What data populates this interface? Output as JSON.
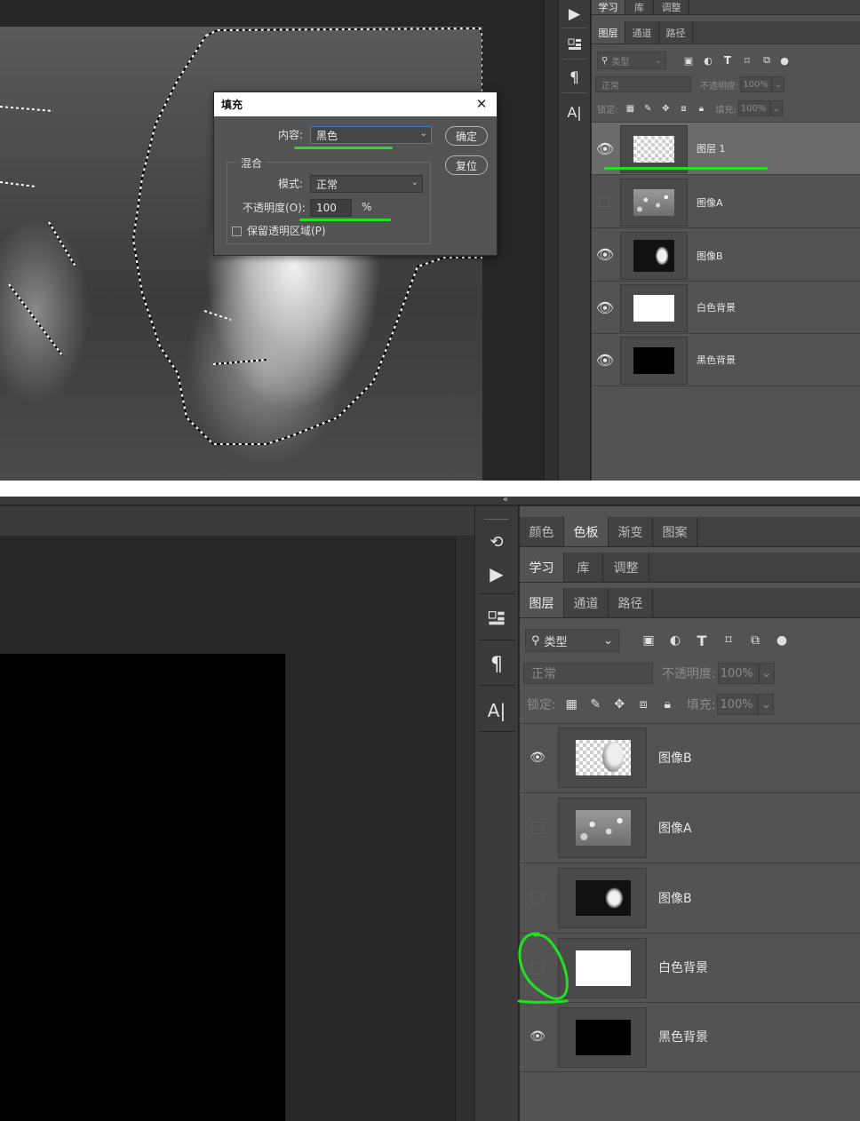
{
  "top": {
    "panel_tabs_a": [
      "学习",
      "库",
      "调整"
    ],
    "panel_tabs_b": [
      "图层",
      "通道",
      "路径"
    ],
    "filter": {
      "label": "类型"
    },
    "blend_mode": "正常",
    "opacity": {
      "label": "不透明度:",
      "value": "100%"
    },
    "lock": {
      "label": "锁定:"
    },
    "fill": {
      "label": "填充:",
      "value": "100%"
    },
    "layers": [
      {
        "name": "图层 1",
        "visible": true,
        "thumb": "transparent",
        "selected": true
      },
      {
        "name": "图像A",
        "visible": false,
        "thumb": "flowers",
        "selected": false
      },
      {
        "name": "图像B",
        "visible": true,
        "thumb": "portrait",
        "selected": false
      },
      {
        "name": "白色背景",
        "visible": true,
        "thumb": "white",
        "selected": false
      },
      {
        "name": "黑色背景",
        "visible": true,
        "thumb": "black",
        "selected": false
      }
    ],
    "dialog": {
      "title": "填充",
      "content_label": "内容:",
      "content_value": "黑色",
      "blend_group": "混合",
      "mode_label": "模式:",
      "mode_value": "正常",
      "opacity_label": "不透明度(O):",
      "opacity_value": "100",
      "percent": "%",
      "preserve_label": "保留透明区域(P)",
      "ok": "确定",
      "reset": "复位"
    }
  },
  "bottom": {
    "collapse": "«",
    "panel_tabs_color": [
      "颜色",
      "色板",
      "渐变",
      "图案"
    ],
    "panel_tabs_a": [
      "学习",
      "库",
      "调整"
    ],
    "panel_tabs_b": [
      "图层",
      "通道",
      "路径"
    ],
    "filter": {
      "label": "类型"
    },
    "blend_mode": "正常",
    "opacity": {
      "label": "不透明度:",
      "value": "100%"
    },
    "lock": {
      "label": "锁定:"
    },
    "fill": {
      "label": "填充:",
      "value": "100%"
    },
    "layers": [
      {
        "name": "图像B",
        "visible": true,
        "thumb": "portrait-transparent"
      },
      {
        "name": "图像A",
        "visible": false,
        "thumb": "flowers"
      },
      {
        "name": "图像B",
        "visible": false,
        "thumb": "portrait"
      },
      {
        "name": "白色背景",
        "visible": false,
        "thumb": "white"
      },
      {
        "name": "黑色背景",
        "visible": true,
        "thumb": "black"
      }
    ]
  },
  "colors": {
    "highlight": "#22e022",
    "panel": "#535353",
    "canvas": "#2b2b2b"
  }
}
